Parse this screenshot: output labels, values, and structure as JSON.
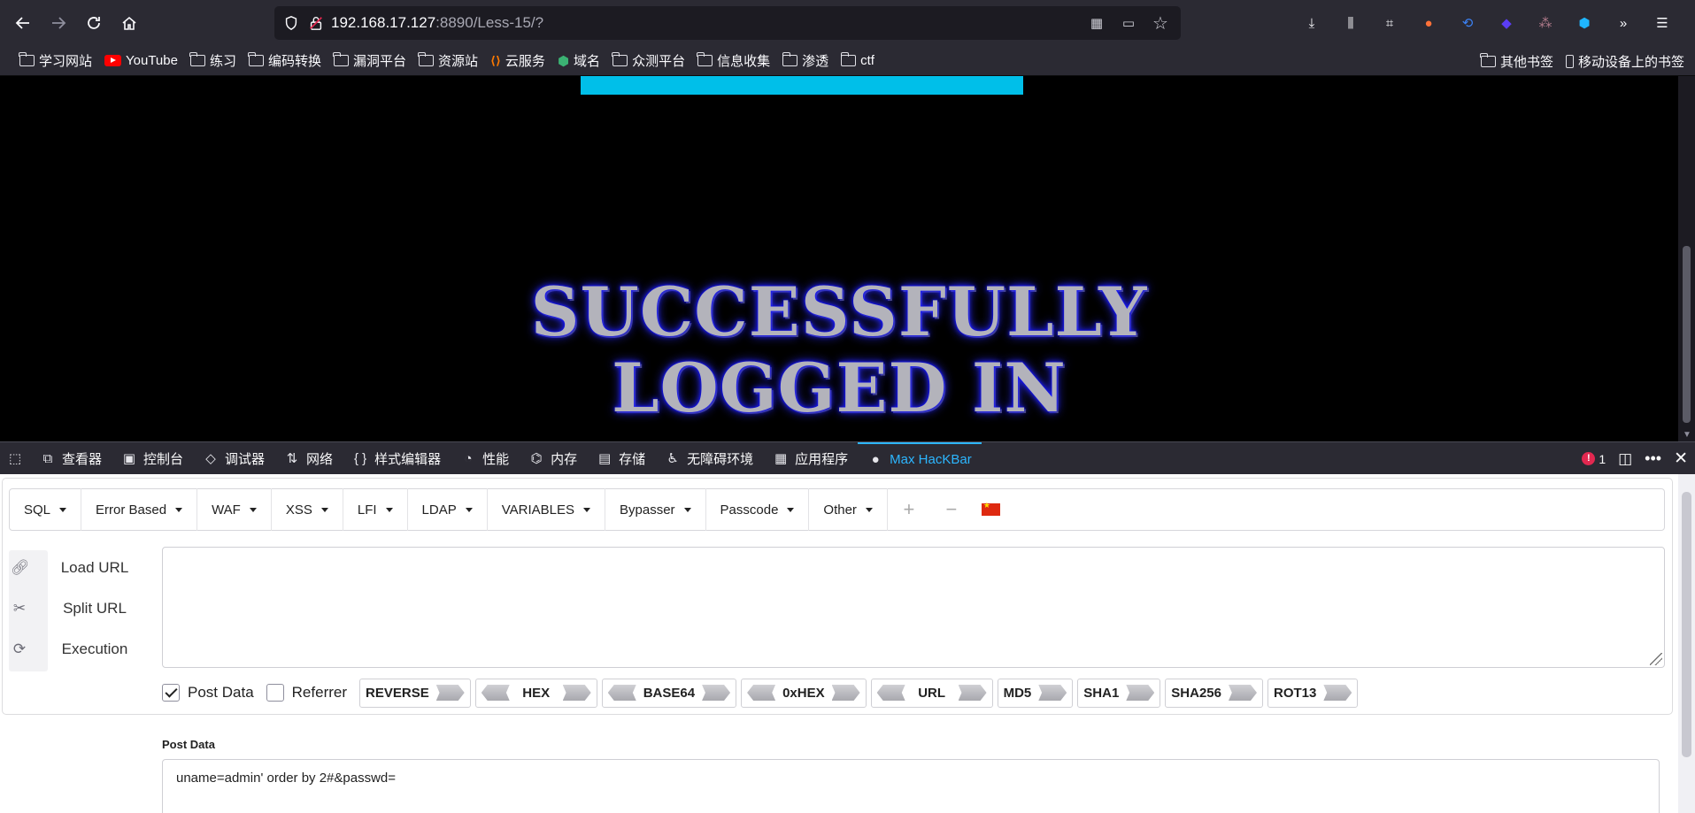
{
  "browser": {
    "url_host": "192.168.17.127",
    "url_rest": ":8890/Less-15/?"
  },
  "bookmarks": [
    {
      "label": "学习网站",
      "icon": "folder-icon"
    },
    {
      "label": "YouTube",
      "icon": "youtube-icon"
    },
    {
      "label": "练习",
      "icon": "folder-icon"
    },
    {
      "label": "编码转换",
      "icon": "folder-icon"
    },
    {
      "label": "漏洞平台",
      "icon": "folder-icon"
    },
    {
      "label": "资源站",
      "icon": "folder-icon"
    },
    {
      "label": "云服务",
      "icon": "cloud-service-icon"
    },
    {
      "label": "域名",
      "icon": "domain-icon"
    },
    {
      "label": "众测平台",
      "icon": "folder-icon"
    },
    {
      "label": "信息收集",
      "icon": "folder-icon"
    },
    {
      "label": "渗透",
      "icon": "folder-icon"
    },
    {
      "label": "ctf",
      "icon": "folder-icon"
    }
  ],
  "bookmarks_right": {
    "other": "其他书签",
    "mobile": "移动设备上的书签"
  },
  "page": {
    "line1": "SUCCESSFULLY",
    "line2": "LOGGED IN",
    "bar_color": "#00bfe9"
  },
  "devtools": {
    "tabs": [
      "查看器",
      "控制台",
      "调试器",
      "网络",
      "样式编辑器",
      "性能",
      "内存",
      "存储",
      "无障碍环境",
      "应用程序",
      "Max HacKBar"
    ],
    "active_tab": "Max HacKBar",
    "error_count": "1",
    "accent": "#2cb6ff"
  },
  "hackbar": {
    "menus": [
      "SQL",
      "Error Based",
      "WAF",
      "XSS",
      "LFI",
      "LDAP",
      "VARIABLES",
      "Bypasser",
      "Passcode",
      "Other"
    ],
    "actions": {
      "load": "Load URL",
      "split": "Split URL",
      "exec": "Execution"
    },
    "url_value": "",
    "post_data_label": "Post Data",
    "referrer_label": "Referrer",
    "encoders": [
      "REVERSE",
      "HEX",
      "BASE64",
      "0xHEX",
      "URL",
      "MD5",
      "SHA1",
      "SHA256",
      "ROT13"
    ],
    "post_data_title": "Post Data",
    "post_data_value": "uname=admin' order by 2#&passwd="
  }
}
